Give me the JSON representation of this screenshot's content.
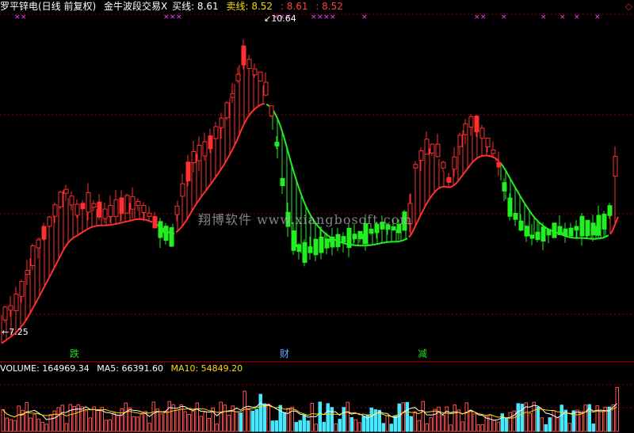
{
  "header": {
    "title": "罗平锌电(日线 前复权)",
    "indicator": "金牛波段交易X",
    "buy_label": "买线: 8.61",
    "sell_label": "卖线: 8.52",
    "val1": ": 8.61",
    "val2": ": 8.52"
  },
  "annotations": {
    "high": "10.64",
    "low": "7.25",
    "watermark": "翔博软件 www.xiangbosoft.com"
  },
  "signals": [
    {
      "label": "跌",
      "color": "#22dd22"
    },
    {
      "label": "财",
      "color": "#66aaff"
    },
    {
      "label": "减",
      "color": "#22dd22"
    }
  ],
  "volume": {
    "label": "VOLUME: 164969.34",
    "ma5": "MA5: 66391.60",
    "ma10": "MA10: 54849.20"
  },
  "colors": {
    "up": "#ff3030",
    "down": "#22ee22",
    "vol_up": "#ff5050",
    "vol_down": "#44e8ff",
    "white_text": "#ffffff",
    "yellow": "#ffd800",
    "magenta": "#ff44ff",
    "grid": "#8b0000"
  }
}
